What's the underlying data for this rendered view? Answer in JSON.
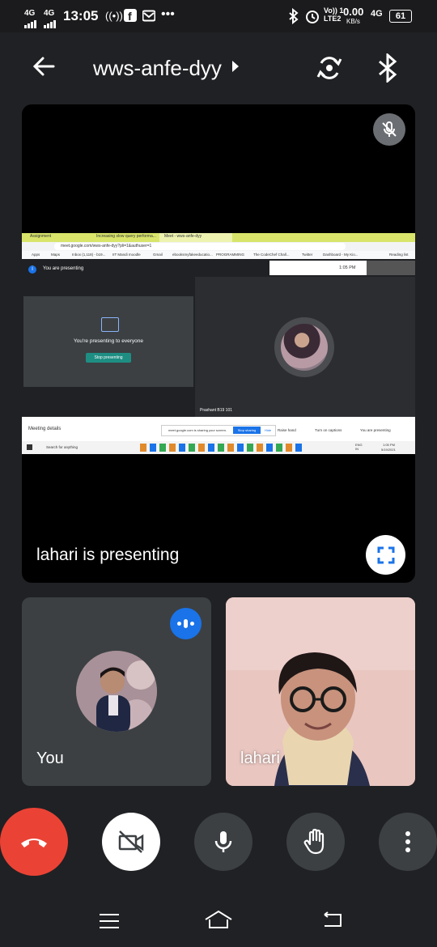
{
  "status_bar": {
    "time": "13:05",
    "net1": "4G",
    "net2": "4G",
    "volte": "Vo)) 1\nLTE2",
    "speed": "0.00",
    "speed_unit": "KB/s",
    "net3": "4G",
    "battery": "61"
  },
  "header": {
    "meeting_code": "wws-anfe-dyy"
  },
  "presentation": {
    "label": "lahari is presenting",
    "screen": {
      "tabs": [
        "Assignment",
        "Increasing slow query performa...",
        "Meet - wws-anfe-dyy"
      ],
      "url": "meet.google.com/wws-anfe-dyy?pli=1&authuser=1",
      "bookmarks": [
        "Apps",
        "Maps",
        "Inbox (1,118) - b19...",
        "IIT Mandi moodle",
        "Gmail",
        "ebooksmyfakeeducatio...",
        "PROGRAMMING",
        "The CodeChef Chall...",
        "Twitter",
        "Dashboard - My Kio...",
        "Reading list"
      ],
      "you_are_presenting": "You are presenting",
      "clock": "1:05 PM",
      "presenting_to_everyone": "You're presenting to everyone",
      "stop_presenting": "Stop presenting",
      "participant_label": "Prashant B19 101",
      "meeting_details": "Meeting details",
      "sharing_notice": "meet.google.com is sharing your screen.",
      "stop_sharing": "Stop sharing",
      "hide": "Hide",
      "raise_hand": "Raise hand",
      "turn_on_captions": "Turn on captions",
      "you_are_presenting_btn": "You are presenting",
      "search_placeholder": "Search for anything",
      "tray_time": "1:05 PM",
      "tray_date": "5/19/2021",
      "tray_lang": "ENG\nIN"
    }
  },
  "tiles": [
    {
      "name": "You"
    },
    {
      "name": "lahari"
    }
  ],
  "colors": {
    "end_call": "#ea4335",
    "background": "#202124",
    "tile": "#3c4043",
    "speaking_badge": "#1a73e8",
    "meet_teal": "#1e8e83"
  }
}
